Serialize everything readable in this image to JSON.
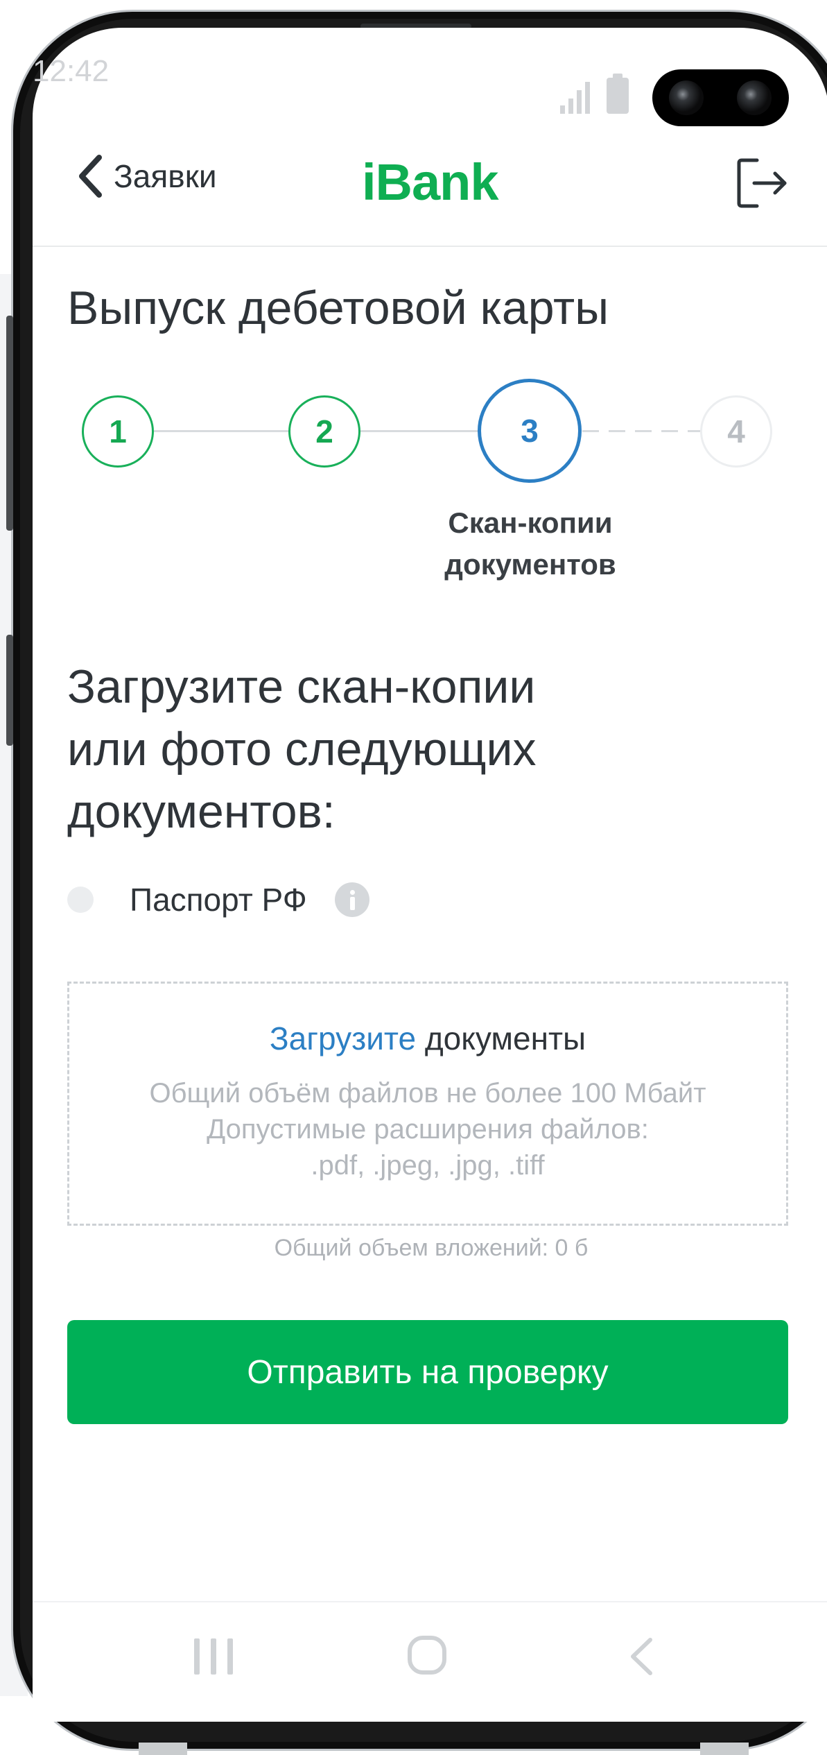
{
  "status_bar": {
    "time": "12:42"
  },
  "header": {
    "back_label": "Заявки",
    "app_name": "iBank"
  },
  "page_title": "Выпуск дебетовой карты",
  "stepper": {
    "steps": [
      {
        "number": "1",
        "state": "done"
      },
      {
        "number": "2",
        "state": "done"
      },
      {
        "number": "3",
        "state": "active"
      },
      {
        "number": "4",
        "state": "todo"
      }
    ],
    "active_caption_line1": "Скан-копии",
    "active_caption_line2": "документов"
  },
  "upload": {
    "heading_line1": "Загрузите скан-копии",
    "heading_line2": "или фото следующих",
    "heading_line3": "документов:",
    "document_label": "Паспорт РФ",
    "dropzone_link": "Загрузите",
    "dropzone_text": "документы",
    "size_limit": "Общий объём файлов не более 100 Мбайт",
    "extensions_label": "Допустимые расширения файлов:",
    "extensions_list": ".pdf, .jpeg, .jpg, .tiff",
    "total_attachments": "Общий объем вложений: 0 б"
  },
  "submit_label": "Отправить на проверку",
  "colors": {
    "brand_green": "#00b057",
    "accent_blue": "#2c7fc4"
  },
  "icons": [
    "chevron-left-icon",
    "logout-icon",
    "info-icon",
    "signal-icon",
    "battery-icon",
    "nav-recents-icon",
    "nav-home-icon",
    "nav-back-icon"
  ]
}
